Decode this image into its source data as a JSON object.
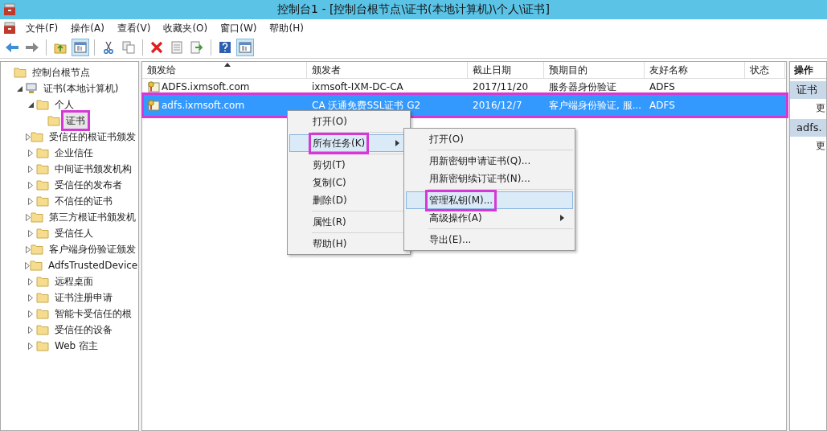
{
  "window": {
    "title": "控制台1 - [控制台根节点\\证书(本地计算机)\\个人\\证书]"
  },
  "menu_bar": [
    "文件(F)",
    "操作(A)",
    "查看(V)",
    "收藏夹(O)",
    "窗口(W)",
    "帮助(H)"
  ],
  "toolbar": [
    {
      "kind": "back",
      "pressed": false
    },
    {
      "kind": "forward",
      "pressed": false
    },
    {
      "kind": "separator"
    },
    {
      "kind": "folder-up",
      "pressed": false
    },
    {
      "kind": "pane",
      "pressed": true
    },
    {
      "kind": "separator"
    },
    {
      "kind": "cut",
      "pressed": false
    },
    {
      "kind": "copy",
      "pressed": false
    },
    {
      "kind": "separator"
    },
    {
      "kind": "delete",
      "pressed": false
    },
    {
      "kind": "properties",
      "pressed": false
    },
    {
      "kind": "export",
      "pressed": false
    },
    {
      "kind": "separator"
    },
    {
      "kind": "help",
      "pressed": false
    },
    {
      "kind": "pane",
      "pressed": true
    }
  ],
  "tree": [
    {
      "label": "控制台根节点",
      "kind": "folder",
      "children": [
        {
          "label": "证书(本地计算机)",
          "kind": "computer",
          "expanded": true,
          "children": [
            {
              "label": "个人",
              "kind": "folder",
              "expanded": true,
              "children": [
                {
                  "label": "证书",
                  "kind": "folder",
                  "selected": true,
                  "highlighted": true
                }
              ]
            },
            {
              "label": "受信任的根证书颁发",
              "kind": "folder",
              "expanded": false
            },
            {
              "label": "企业信任",
              "kind": "folder",
              "expanded": false
            },
            {
              "label": "中间证书颁发机构",
              "kind": "folder",
              "expanded": false
            },
            {
              "label": "受信任的发布者",
              "kind": "folder",
              "expanded": false
            },
            {
              "label": "不信任的证书",
              "kind": "folder",
              "expanded": false
            },
            {
              "label": "第三方根证书颁发机",
              "kind": "folder",
              "expanded": false
            },
            {
              "label": "受信任人",
              "kind": "folder",
              "expanded": false
            },
            {
              "label": "客户端身份验证颁发",
              "kind": "folder",
              "expanded": false
            },
            {
              "label": "AdfsTrustedDevice",
              "kind": "folder",
              "expanded": false
            },
            {
              "label": "远程桌面",
              "kind": "folder",
              "expanded": false
            },
            {
              "label": "证书注册申请",
              "kind": "folder",
              "expanded": false
            },
            {
              "label": "智能卡受信任的根",
              "kind": "folder",
              "expanded": false
            },
            {
              "label": "受信任的设备",
              "kind": "folder",
              "expanded": false
            },
            {
              "label": "Web 宿主",
              "kind": "folder",
              "expanded": false
            }
          ]
        }
      ]
    }
  ],
  "table": {
    "columns": [
      {
        "label": "颁发给",
        "sorted": true
      },
      {
        "label": "颁发者",
        "sorted": false
      },
      {
        "label": "截止日期",
        "sorted": false
      },
      {
        "label": "预期目的",
        "sorted": false
      },
      {
        "label": "友好名称",
        "sorted": false
      },
      {
        "label": "状态",
        "sorted": false
      }
    ],
    "rows": [
      {
        "cells": [
          "ADFS.ixmsoft.com",
          "ixmsoft-IXM-DC-CA",
          "2017/11/20",
          "服务器身份验证",
          "ADFS"
        ],
        "selected": false,
        "highlighted": false
      },
      {
        "cells": [
          "adfs.ixmsoft.com",
          "CA 沃通免费SSL证书 G2",
          "2016/12/7",
          "客户端身份验证, 服...",
          "ADFS"
        ],
        "selected": true,
        "highlighted": true
      }
    ]
  },
  "context_menu": [
    {
      "kind": "item",
      "label": "打开(O)",
      "selected": false,
      "highlighted": false,
      "submenu": false
    },
    {
      "kind": "separator"
    },
    {
      "kind": "item",
      "label": "所有任务(K)",
      "selected": true,
      "highlighted": true,
      "submenu": true
    },
    {
      "kind": "separator"
    },
    {
      "kind": "item",
      "label": "剪切(T)",
      "selected": false,
      "highlighted": false,
      "submenu": false
    },
    {
      "kind": "item",
      "label": "复制(C)",
      "selected": false,
      "highlighted": false,
      "submenu": false
    },
    {
      "kind": "item",
      "label": "删除(D)",
      "selected": false,
      "highlighted": false,
      "submenu": false
    },
    {
      "kind": "separator"
    },
    {
      "kind": "item",
      "label": "属性(R)",
      "selected": false,
      "highlighted": false,
      "submenu": false
    },
    {
      "kind": "separator"
    },
    {
      "kind": "item",
      "label": "帮助(H)",
      "selected": false,
      "highlighted": false,
      "submenu": false
    }
  ],
  "submenu": [
    {
      "kind": "item",
      "label": "打开(O)",
      "selected": false,
      "highlighted": false,
      "submenu": false
    },
    {
      "kind": "separator"
    },
    {
      "kind": "item",
      "label": "用新密钥申请证书(Q)...",
      "selected": false,
      "highlighted": false,
      "submenu": false
    },
    {
      "kind": "item",
      "label": "用新密钥续订证书(N)...",
      "selected": false,
      "highlighted": false,
      "submenu": false
    },
    {
      "kind": "separator"
    },
    {
      "kind": "item",
      "label": "管理私钥(M)...",
      "selected": true,
      "highlighted": true,
      "submenu": false
    },
    {
      "kind": "item",
      "label": "高级操作(A)",
      "selected": false,
      "highlighted": false,
      "submenu": true
    },
    {
      "kind": "separator"
    },
    {
      "kind": "item",
      "label": "导出(E)...",
      "selected": false,
      "highlighted": false,
      "submenu": false
    }
  ],
  "actions": {
    "title": "操作",
    "sections": [
      {
        "header": "证书",
        "items": [
          "更"
        ]
      },
      {
        "header": "adfs.",
        "items": [
          "更"
        ]
      }
    ]
  }
}
